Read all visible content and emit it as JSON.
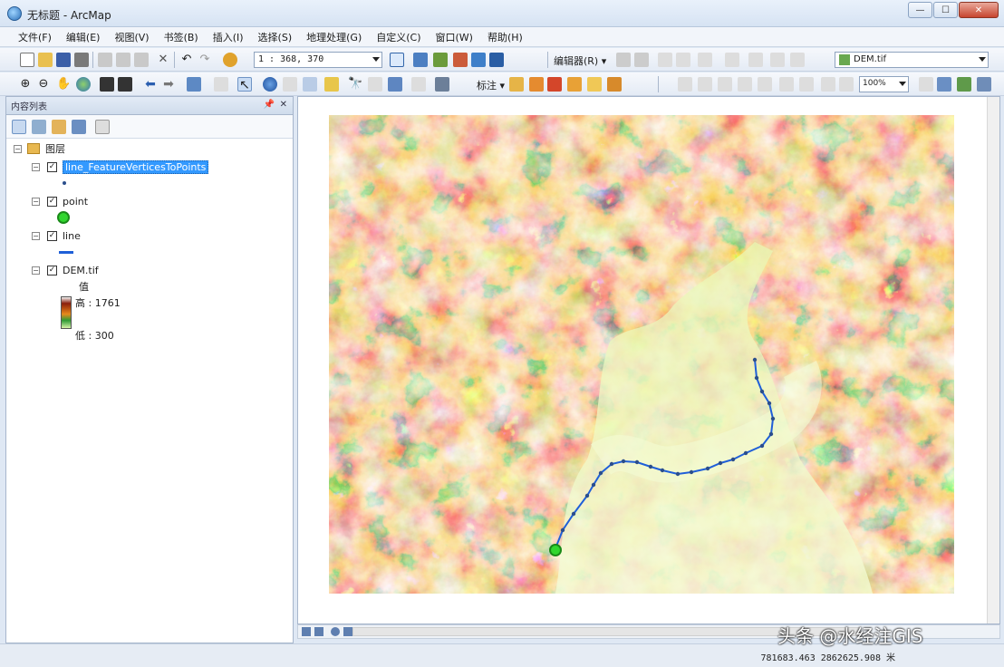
{
  "window": {
    "title": "无标题 - ArcMap"
  },
  "menu": [
    "文件(F)",
    "编辑(E)",
    "视图(V)",
    "书签(B)",
    "插入(I)",
    "选择(S)",
    "地理处理(G)",
    "自定义(C)",
    "窗口(W)",
    "帮助(H)"
  ],
  "toolbar": {
    "scale": "1 : 368, 370",
    "editor_label": "编辑器(R) ▾",
    "target_layer": "DEM.tif",
    "label_tool": "标注 ▾",
    "zoom_level": "100%"
  },
  "toc": {
    "title": "内容列表",
    "group": "图层",
    "layers": [
      {
        "name": "line_FeatureVerticesToPoints",
        "checked": true,
        "selected": true
      },
      {
        "name": "point",
        "checked": true
      },
      {
        "name": "line",
        "checked": true
      },
      {
        "name": "DEM.tif",
        "checked": true
      }
    ],
    "legend": {
      "header": "值",
      "high": "高 : 1761",
      "low": "低 : 300"
    }
  },
  "status": {
    "coordinates": "781683.463  2862625.908 米"
  },
  "watermark": "头条 @水经注GIS",
  "colors": {
    "accent": "#3399ff",
    "line": "#1f5fd8",
    "point": "#31d62f"
  }
}
